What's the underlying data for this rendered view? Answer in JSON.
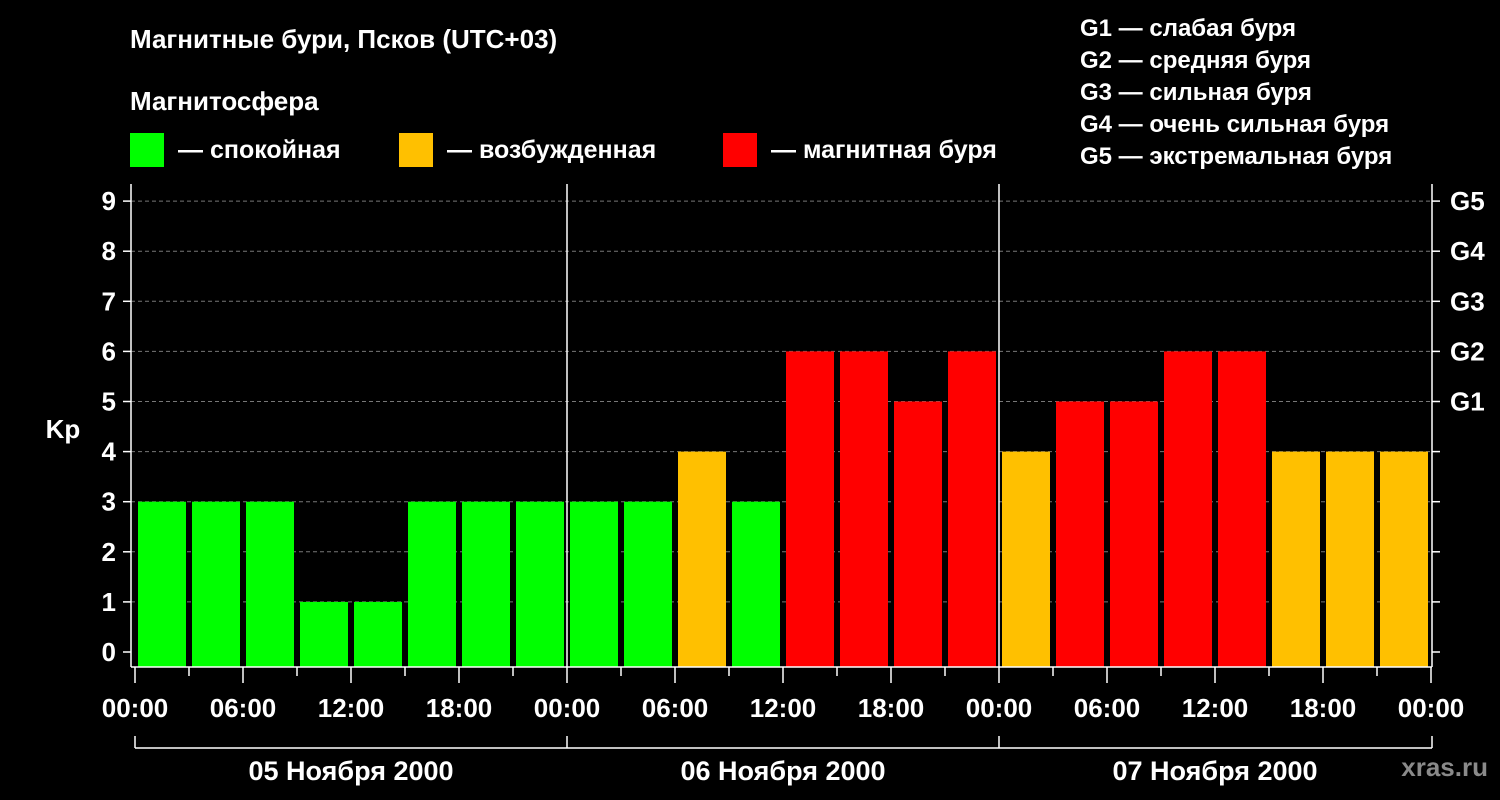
{
  "header": {
    "title": "Магнитные бури, Псков (UTC+03)",
    "subtitle": "Магнитосфера"
  },
  "legend": [
    {
      "color": "#00ff00",
      "label": "— спокойная"
    },
    {
      "color": "#ffc000",
      "label": "— возбужденная"
    },
    {
      "color": "#ff0000",
      "label": "— магнитная буря"
    }
  ],
  "storm_scale": [
    "G1 — слабая буря",
    "G2 — средняя буря",
    "G3 — сильная буря",
    "G4 — очень сильная буря",
    "G5 — экстремальная буря"
  ],
  "watermark": "xras.ru",
  "chart_data": {
    "type": "bar",
    "title": "Магнитные бури, Псков (UTC+03)",
    "ylabel": "Kp",
    "ylim": [
      0,
      9
    ],
    "y_ticks": [
      "0",
      "1",
      "2",
      "3",
      "4",
      "5",
      "6",
      "7",
      "8",
      "9"
    ],
    "right_ticks": [
      {
        "kp": 5,
        "label": "G1"
      },
      {
        "kp": 6,
        "label": "G2"
      },
      {
        "kp": 7,
        "label": "G3"
      },
      {
        "kp": 8,
        "label": "G4"
      },
      {
        "kp": 9,
        "label": "G5"
      }
    ],
    "x_tick_labels": [
      "00:00",
      "06:00",
      "12:00",
      "18:00",
      "00:00",
      "06:00",
      "12:00",
      "18:00",
      "00:00",
      "06:00",
      "12:00",
      "18:00",
      "00:00"
    ],
    "days": [
      "05 Ноября 2000",
      "06 Ноября 2000",
      "07 Ноября 2000"
    ],
    "grid": true,
    "values": [
      3,
      3,
      3,
      1,
      1,
      3,
      3,
      3,
      3,
      3,
      4,
      3,
      6,
      6,
      5,
      6,
      4,
      5,
      5,
      6,
      6,
      4,
      4,
      4
    ],
    "categories": [
      "05 Ноября 2000 00:00",
      "05 Ноября 2000 03:00",
      "05 Ноября 2000 06:00",
      "05 Ноября 2000 09:00",
      "05 Ноября 2000 12:00",
      "05 Ноября 2000 15:00",
      "05 Ноября 2000 18:00",
      "05 Ноября 2000 21:00",
      "06 Ноября 2000 00:00",
      "06 Ноября 2000 03:00",
      "06 Ноября 2000 06:00",
      "06 Ноября 2000 09:00",
      "06 Ноября 2000 12:00",
      "06 Ноября 2000 15:00",
      "06 Ноября 2000 18:00",
      "06 Ноября 2000 21:00",
      "07 Ноября 2000 00:00",
      "07 Ноября 2000 03:00",
      "07 Ноября 2000 06:00",
      "07 Ноября 2000 09:00",
      "07 Ноября 2000 12:00",
      "07 Ноября 2000 15:00",
      "07 Ноября 2000 18:00",
      "07 Ноября 2000 21:00"
    ],
    "colors": {
      "quiet": "#00ff00",
      "active": "#ffc000",
      "storm": "#ff0000"
    },
    "thresholds": {
      "active": 4,
      "storm": 5
    }
  }
}
